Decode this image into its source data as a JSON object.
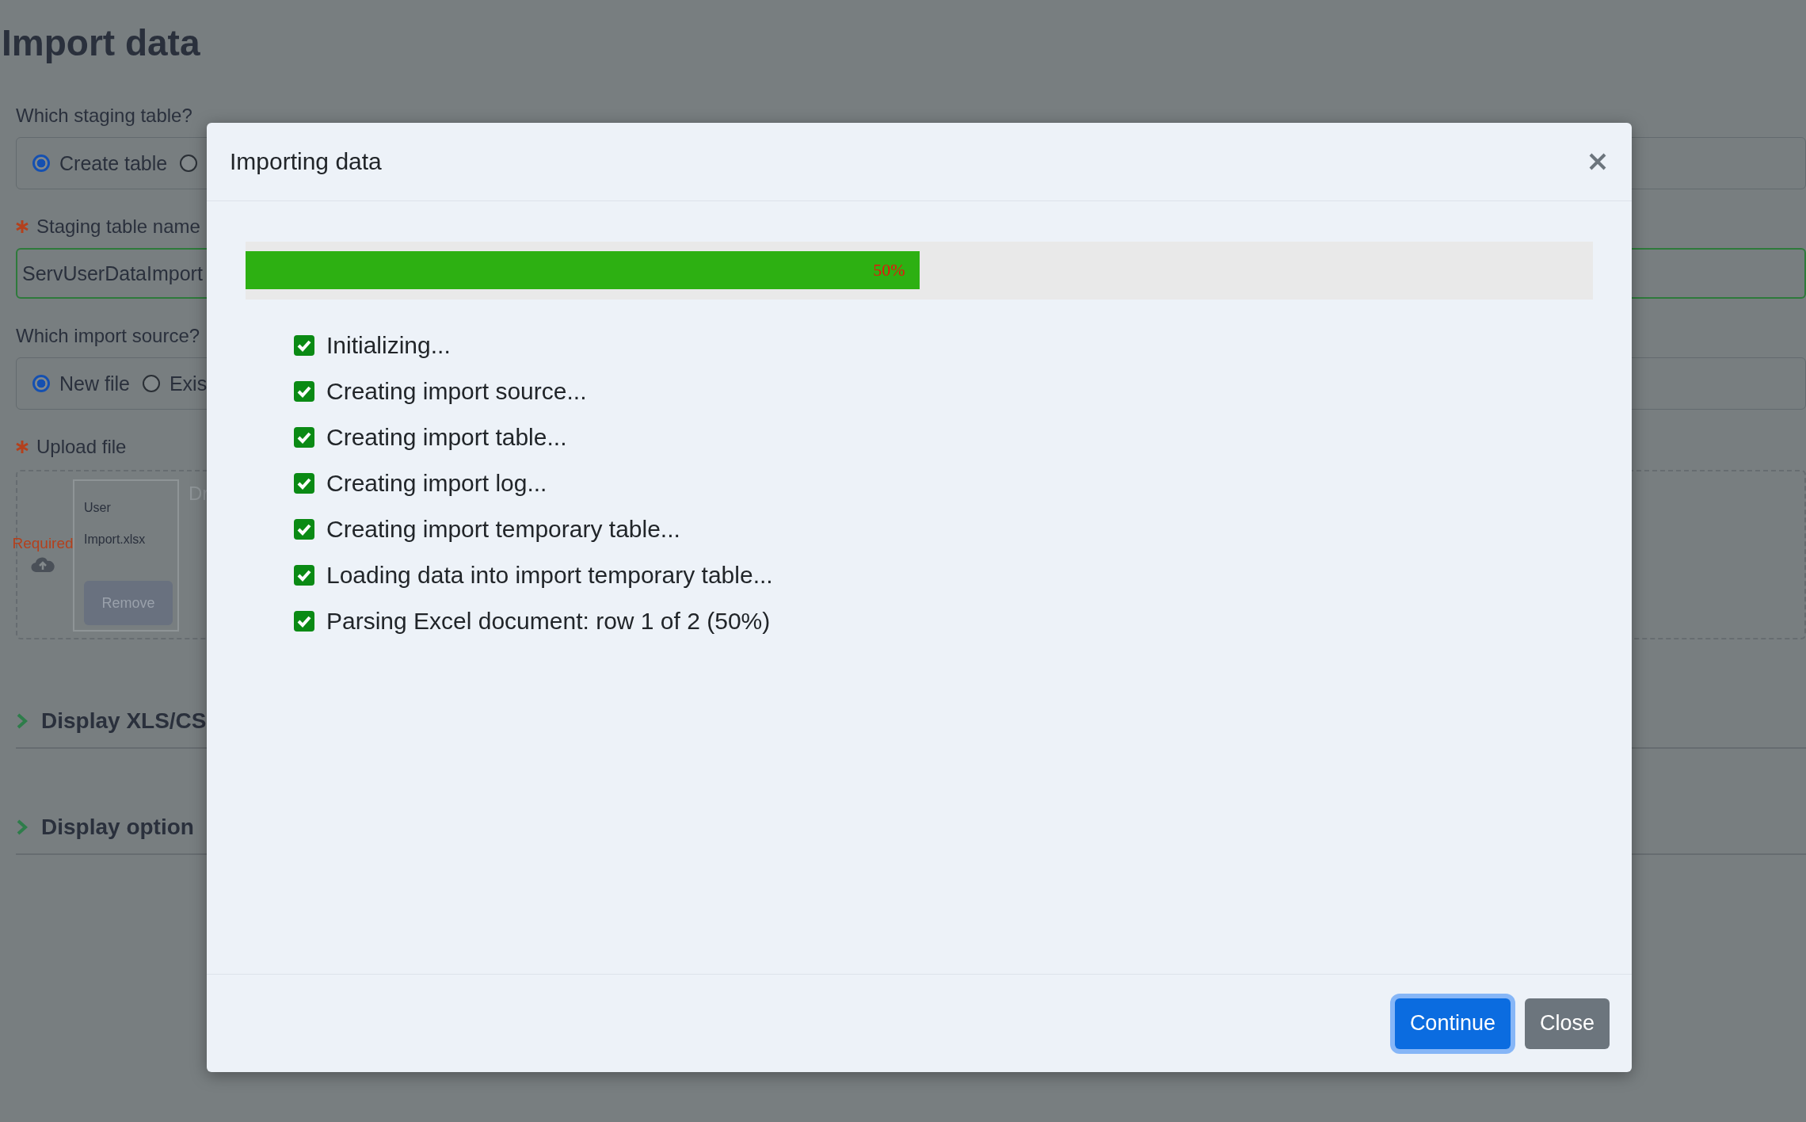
{
  "page": {
    "title": "Import data",
    "staging_table": {
      "label": "Which staging table?",
      "options": [
        {
          "label": "Create table",
          "selected": true
        },
        {
          "selected": false
        }
      ]
    },
    "staging_table_name": {
      "label": "Staging table name",
      "required": true,
      "value": "ServUserDataImport"
    },
    "import_source": {
      "label": "Which import source?",
      "options": [
        {
          "label": "New file",
          "selected": true
        },
        {
          "label": "Exis",
          "selected": false
        }
      ]
    },
    "upload": {
      "label": "Upload file",
      "required": true,
      "error": "Required",
      "file_name": [
        "User",
        "Import.xlsx"
      ],
      "remove_button": "Remove",
      "drop_hint": "Dr"
    },
    "sections": [
      {
        "label": "Display XLS/CS",
        "expanded": false
      },
      {
        "label": "Display option",
        "expanded": false
      }
    ]
  },
  "dialog": {
    "title": "Importing data",
    "progress": {
      "level": 0.5,
      "label": "50%"
    },
    "steps": [
      {
        "text": "Initializing...",
        "checked": true
      },
      {
        "text": "Creating import source...",
        "checked": true
      },
      {
        "text": "Creating import table...",
        "checked": true
      },
      {
        "text": "Creating import log...",
        "checked": true
      },
      {
        "text": "Creating import temporary table...",
        "checked": true
      },
      {
        "text": "Loading data into import temporary table...",
        "checked": true
      },
      {
        "text": "Parsing Excel document: row 1 of 2 (50%)",
        "checked": true
      }
    ],
    "buttons": [
      {
        "label": "Continue",
        "kind": "primary",
        "focused": true
      },
      {
        "label": "Close",
        "kind": "secondary",
        "focused": false
      }
    ]
  }
}
